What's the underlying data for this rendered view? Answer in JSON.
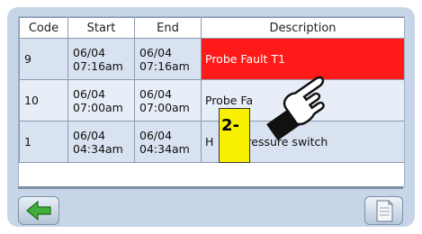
{
  "table": {
    "headers": {
      "code": "Code",
      "start": "Start",
      "end": "End",
      "description": "Description"
    },
    "rows": [
      {
        "code": "9",
        "start_date": "06/04",
        "start_time": "07:16am",
        "end_date": "06/04",
        "end_time": "07:16am",
        "description": "Probe Fault T1",
        "highlighted": true
      },
      {
        "code": "10",
        "start_date": "06/04",
        "start_time": "07:00am",
        "end_date": "06/04",
        "end_time": "07:00am",
        "description": "Probe Fa",
        "highlighted": false
      },
      {
        "code": "1",
        "start_date": "06/04",
        "start_time": "04:34am",
        "end_date": "06/04",
        "end_time": "04:34am",
        "description": "H",
        "description_tail": "ressure switch",
        "highlighted": false
      }
    ]
  },
  "callout": {
    "label": "2-"
  },
  "icons": {
    "back": "back-arrow-icon",
    "document": "document-icon",
    "pointer": "pointing-hand-icon"
  },
  "colors": {
    "highlight": "#ff1a1a",
    "callout": "#f7f000",
    "arrow": "#3fae3a"
  }
}
